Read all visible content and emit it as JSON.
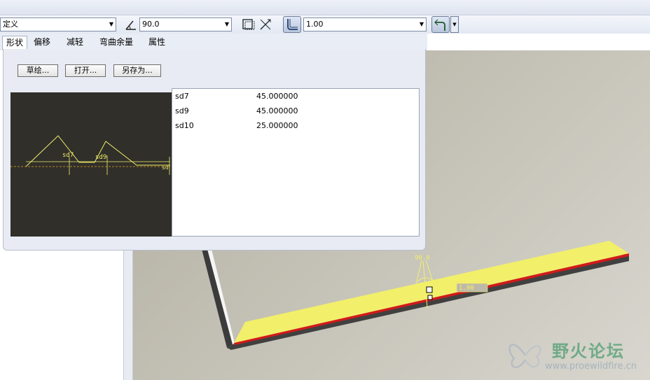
{
  "toolbar": {
    "type_combo_value": "定义",
    "angle_value": "90.0",
    "radius_value": "1.00"
  },
  "tabs": [
    "形状",
    "偏移",
    "减轻",
    "弯曲余量",
    "属性"
  ],
  "panel": {
    "buttons": {
      "sketch": "草绘...",
      "open": "打开...",
      "save_as": "另存为..."
    },
    "dimensions": [
      {
        "name": "sd7",
        "value": "45.000000"
      },
      {
        "name": "sd9",
        "value": "45.000000"
      },
      {
        "name": "sd10",
        "value": "25.000000"
      }
    ],
    "preview_labels": {
      "sd7": "sd7",
      "sd9": "sd9",
      "sd10": "sd"
    }
  },
  "viewport": {
    "angle_tag": "90.0",
    "radius_tag": "1.00"
  },
  "watermark": {
    "title": "野火论坛",
    "url": "www.proewildfire.cn"
  },
  "colors": {
    "flange_yellow": "#f2ef6a",
    "edge_red": "#d11a1a",
    "preview_bg": "#302f2a"
  }
}
